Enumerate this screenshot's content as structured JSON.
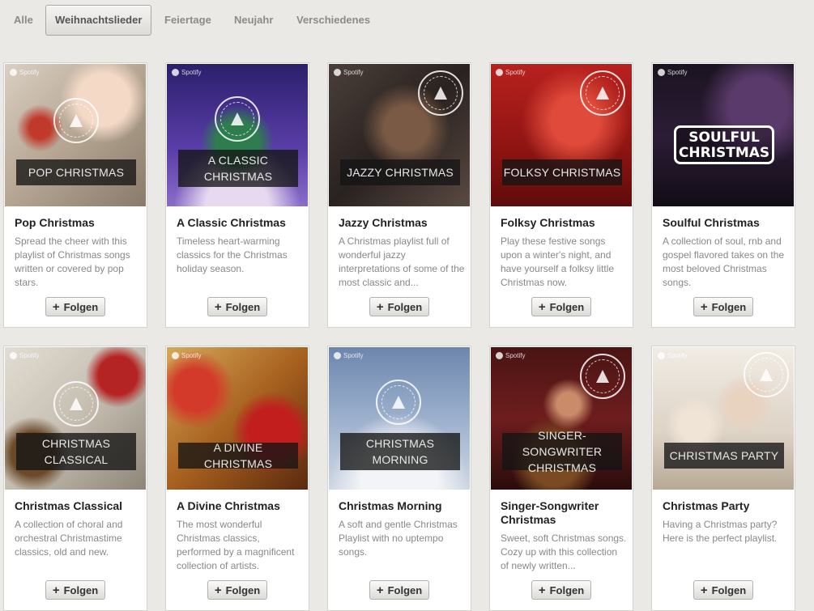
{
  "tabs": [
    "Alle",
    "Weihnachtslieder",
    "Feiertage",
    "Neujahr",
    "Verschiedenes"
  ],
  "active_tab": "Weihnachtslieder",
  "follow_label": "Folgen",
  "brand": "Spotify",
  "playlists": [
    {
      "cover_text": "POP CHRISTMAS",
      "title": "Pop Christmas",
      "desc": "Spread the cheer with this playlist of Christmas songs written or covered by pop stars."
    },
    {
      "cover_text": "A CLASSIC CHRISTMAS",
      "title": "A Classic Christmas",
      "desc": "Timeless heart-warming classics for the Christmas holiday season."
    },
    {
      "cover_text": "JAZZY CHRISTMAS",
      "title": "Jazzy Christmas",
      "desc": "A Christmas playlist full of wonderful jazzy interpretations of some of the most classic and..."
    },
    {
      "cover_text": "FOLKSY CHRISTMAS",
      "title": "Folksy Christmas",
      "desc": "Play these festive songs upon a winter's night, and have yourself a folksy little Christmas now."
    },
    {
      "cover_text": "SOULFUL CHRISTMAS",
      "title": "Soulful Christmas",
      "desc": "A collection of soul, rnb and gospel flavored takes on the most beloved Christmas songs."
    },
    {
      "cover_text": "CHRISTMAS CLASSICAL",
      "title": "Christmas Classical",
      "desc": "A collection of choral and orchestral Christmastime classics, old and new."
    },
    {
      "cover_text": "A DIVINE CHRISTMAS",
      "title": "A Divine Christmas",
      "desc": "The most wonderful Christmas classics, performed by a magnificent collection of artists."
    },
    {
      "cover_text": "CHRISTMAS MORNING",
      "title": "Christmas Morning",
      "desc": "A soft and gentle Christmas Playlist with no uptempo songs."
    },
    {
      "cover_text": "SINGER-SONGWRITER CHRISTMAS",
      "title": "Singer-Songwriter Christmas",
      "desc": "Sweet, soft Christmas songs. Cozy up with this collection of newly written..."
    },
    {
      "cover_text": "CHRISTMAS PARTY",
      "title": "Christmas Party",
      "desc": "Having a Christmas party? Here is the perfect playlist."
    }
  ],
  "colors": {
    "page_bg": "#ebe9e6",
    "card_bg": "#ffffff",
    "title_text": "#222222",
    "desc_text": "#8a8886"
  }
}
